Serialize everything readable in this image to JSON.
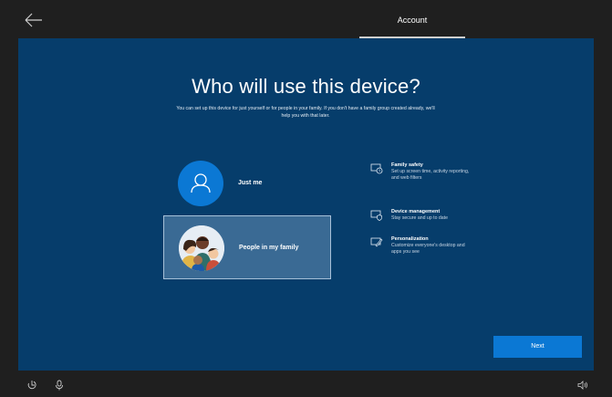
{
  "header": {
    "step_title": "Account"
  },
  "main": {
    "heading": "Who will use this device?",
    "subtext": "You can set up this device for just yourself or for people in your family. If you don't have a family group created already, we'll help you with that later.",
    "options": [
      {
        "label": "Just me",
        "icon": "person-icon"
      },
      {
        "label": "People in my family",
        "icon": "family-illustration",
        "selected": true
      }
    ],
    "features": [
      {
        "title": "Family safety",
        "description": "Set up screen time, activity reporting, and web filters",
        "icon": "clock-screen-icon"
      },
      {
        "title": "Device management",
        "description": "Stay secure and up to date",
        "icon": "shield-screen-icon"
      },
      {
        "title": "Personalization",
        "description": "Customize everyone's desktop and apps you see",
        "icon": "pen-screen-icon"
      }
    ],
    "next_label": "Next"
  },
  "footer": {
    "icons": [
      "accessibility-icon",
      "microphone-icon",
      "speaker-icon"
    ]
  },
  "colors": {
    "panel_bg": "#063d6b",
    "accent": "#0b78d4",
    "selected_bg": "#3a6a94",
    "chrome_bg": "#1f1f1f"
  }
}
